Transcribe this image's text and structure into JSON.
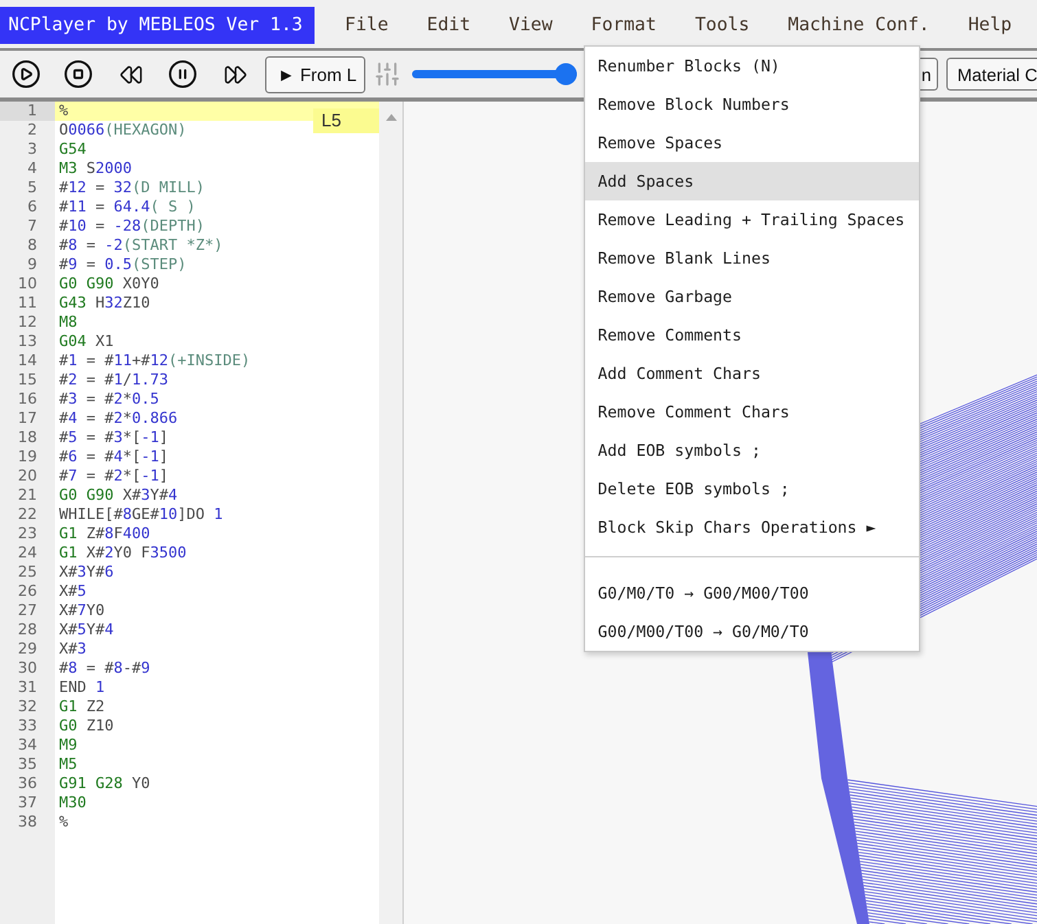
{
  "app_title": "NCPlayer by MEBLEOS Ver 1.3",
  "menubar": [
    {
      "label": "File"
    },
    {
      "label": "Edit"
    },
    {
      "label": "View"
    },
    {
      "label": "Format",
      "entries": [
        {
          "kind": "item",
          "label": "Renumber Blocks (N)",
          "highlighted": false
        },
        {
          "kind": "item",
          "label": "Remove Block Numbers",
          "highlighted": false
        },
        {
          "kind": "item",
          "label": "Remove Spaces",
          "highlighted": false
        },
        {
          "kind": "item",
          "label": "Add Spaces",
          "highlighted": true
        },
        {
          "kind": "item",
          "label": "Remove Leading + Trailing Spaces",
          "highlighted": false
        },
        {
          "kind": "item",
          "label": "Remove Blank Lines",
          "highlighted": false
        },
        {
          "kind": "item",
          "label": "Remove Garbage",
          "highlighted": false
        },
        {
          "kind": "item",
          "label": "Remove Comments",
          "highlighted": false
        },
        {
          "kind": "item",
          "label": "Add Comment Chars",
          "highlighted": false
        },
        {
          "kind": "item",
          "label": "Remove Comment Chars",
          "highlighted": false
        },
        {
          "kind": "item",
          "label": "Add EOB symbols ;",
          "highlighted": false
        },
        {
          "kind": "item",
          "label": "Delete EOB symbols ;",
          "highlighted": false
        },
        {
          "kind": "item",
          "label": "Block Skip Chars Operations ►",
          "highlighted": false
        },
        {
          "kind": "separator"
        },
        {
          "kind": "item",
          "label": "G0/M0/T0 → G00/M00/T00",
          "highlighted": false
        },
        {
          "kind": "item",
          "label": "G00/M00/T00 → G0/M0/T0",
          "highlighted": false
        }
      ]
    },
    {
      "label": "Tools"
    },
    {
      "label": "Machine Conf."
    },
    {
      "label": "Help"
    }
  ],
  "toolbar": {
    "from_line_button": "► From L",
    "speed_slider": {
      "level": 1
    },
    "buttons": [
      "n",
      "Material C"
    ]
  },
  "editor": {
    "tooltip": "L5",
    "lines": [
      {
        "number": "1",
        "current": true,
        "tokens": [
          {
            "kind": "plain",
            "text": "%"
          }
        ]
      },
      {
        "number": "2",
        "current": false,
        "tokens": [
          {
            "kind": "plain",
            "text": "O"
          },
          {
            "kind": "num",
            "text": "0066"
          },
          {
            "kind": "comment",
            "text": "(HEXAGON)"
          }
        ]
      },
      {
        "number": "3",
        "current": false,
        "tokens": [
          {
            "kind": "code",
            "text": "G54"
          }
        ]
      },
      {
        "number": "4",
        "current": false,
        "tokens": [
          {
            "kind": "code",
            "text": "M3"
          },
          {
            "kind": "plain",
            "text": " S"
          },
          {
            "kind": "num",
            "text": "2000"
          }
        ]
      },
      {
        "number": "5",
        "current": false,
        "tokens": [
          {
            "kind": "plain",
            "text": "#"
          },
          {
            "kind": "num",
            "text": "12"
          },
          {
            "kind": "plain",
            "text": " = "
          },
          {
            "kind": "num",
            "text": "32"
          },
          {
            "kind": "comment",
            "text": "(D MILL)"
          }
        ]
      },
      {
        "number": "6",
        "current": false,
        "tokens": [
          {
            "kind": "plain",
            "text": "#"
          },
          {
            "kind": "num",
            "text": "11"
          },
          {
            "kind": "plain",
            "text": " = "
          },
          {
            "kind": "num",
            "text": "64.4"
          },
          {
            "kind": "comment",
            "text": "( S )"
          }
        ]
      },
      {
        "number": "7",
        "current": false,
        "tokens": [
          {
            "kind": "plain",
            "text": "#"
          },
          {
            "kind": "num",
            "text": "10"
          },
          {
            "kind": "plain",
            "text": " = "
          },
          {
            "kind": "num",
            "text": "-28"
          },
          {
            "kind": "comment",
            "text": "(DEPTH)"
          }
        ]
      },
      {
        "number": "8",
        "current": false,
        "tokens": [
          {
            "kind": "plain",
            "text": "#"
          },
          {
            "kind": "num",
            "text": "8"
          },
          {
            "kind": "plain",
            "text": " = "
          },
          {
            "kind": "num",
            "text": "-2"
          },
          {
            "kind": "comment",
            "text": "(START *Z*)"
          }
        ]
      },
      {
        "number": "9",
        "current": false,
        "tokens": [
          {
            "kind": "plain",
            "text": "#"
          },
          {
            "kind": "num",
            "text": "9"
          },
          {
            "kind": "plain",
            "text": " = "
          },
          {
            "kind": "num",
            "text": "0.5"
          },
          {
            "kind": "comment",
            "text": "(STEP)"
          }
        ]
      },
      {
        "number": "10",
        "current": false,
        "tokens": [
          {
            "kind": "code",
            "text": "G0 G90"
          },
          {
            "kind": "plain",
            "text": " X0Y0"
          }
        ]
      },
      {
        "number": "11",
        "current": false,
        "tokens": [
          {
            "kind": "code",
            "text": "G43"
          },
          {
            "kind": "plain",
            "text": " H"
          },
          {
            "kind": "num",
            "text": "32"
          },
          {
            "kind": "plain",
            "text": "Z10"
          }
        ]
      },
      {
        "number": "12",
        "current": false,
        "tokens": [
          {
            "kind": "code",
            "text": "M8"
          }
        ]
      },
      {
        "number": "13",
        "current": false,
        "tokens": [
          {
            "kind": "code",
            "text": "G04"
          },
          {
            "kind": "plain",
            "text": " X1"
          }
        ]
      },
      {
        "number": "14",
        "current": false,
        "tokens": [
          {
            "kind": "plain",
            "text": "#"
          },
          {
            "kind": "num",
            "text": "1"
          },
          {
            "kind": "plain",
            "text": " = #"
          },
          {
            "kind": "num",
            "text": "11"
          },
          {
            "kind": "plain",
            "text": "+#"
          },
          {
            "kind": "num",
            "text": "12"
          },
          {
            "kind": "comment",
            "text": "(+INSIDE)"
          }
        ]
      },
      {
        "number": "15",
        "current": false,
        "tokens": [
          {
            "kind": "plain",
            "text": "#"
          },
          {
            "kind": "num",
            "text": "2"
          },
          {
            "kind": "plain",
            "text": " = #"
          },
          {
            "kind": "num",
            "text": "1"
          },
          {
            "kind": "plain",
            "text": "/"
          },
          {
            "kind": "num",
            "text": "1.73"
          }
        ]
      },
      {
        "number": "16",
        "current": false,
        "tokens": [
          {
            "kind": "plain",
            "text": "#"
          },
          {
            "kind": "num",
            "text": "3"
          },
          {
            "kind": "plain",
            "text": " = #"
          },
          {
            "kind": "num",
            "text": "2"
          },
          {
            "kind": "plain",
            "text": "*"
          },
          {
            "kind": "num",
            "text": "0.5"
          }
        ]
      },
      {
        "number": "17",
        "current": false,
        "tokens": [
          {
            "kind": "plain",
            "text": "#"
          },
          {
            "kind": "num",
            "text": "4"
          },
          {
            "kind": "plain",
            "text": " = #"
          },
          {
            "kind": "num",
            "text": "2"
          },
          {
            "kind": "plain",
            "text": "*"
          },
          {
            "kind": "num",
            "text": "0.866"
          }
        ]
      },
      {
        "number": "18",
        "current": false,
        "tokens": [
          {
            "kind": "plain",
            "text": "#"
          },
          {
            "kind": "num",
            "text": "5"
          },
          {
            "kind": "plain",
            "text": " = #"
          },
          {
            "kind": "num",
            "text": "3"
          },
          {
            "kind": "plain",
            "text": "*["
          },
          {
            "kind": "num",
            "text": "-1"
          },
          {
            "kind": "plain",
            "text": "]"
          }
        ]
      },
      {
        "number": "19",
        "current": false,
        "tokens": [
          {
            "kind": "plain",
            "text": "#"
          },
          {
            "kind": "num",
            "text": "6"
          },
          {
            "kind": "plain",
            "text": " = #"
          },
          {
            "kind": "num",
            "text": "4"
          },
          {
            "kind": "plain",
            "text": "*["
          },
          {
            "kind": "num",
            "text": "-1"
          },
          {
            "kind": "plain",
            "text": "]"
          }
        ]
      },
      {
        "number": "20",
        "current": false,
        "tokens": [
          {
            "kind": "plain",
            "text": "#"
          },
          {
            "kind": "num",
            "text": "7"
          },
          {
            "kind": "plain",
            "text": " = #"
          },
          {
            "kind": "num",
            "text": "2"
          },
          {
            "kind": "plain",
            "text": "*["
          },
          {
            "kind": "num",
            "text": "-1"
          },
          {
            "kind": "plain",
            "text": "]"
          }
        ]
      },
      {
        "number": "21",
        "current": false,
        "tokens": [
          {
            "kind": "code",
            "text": "G0 G90"
          },
          {
            "kind": "plain",
            "text": " X#"
          },
          {
            "kind": "num",
            "text": "3"
          },
          {
            "kind": "plain",
            "text": "Y#"
          },
          {
            "kind": "num",
            "text": "4"
          }
        ]
      },
      {
        "number": "22",
        "current": false,
        "tokens": [
          {
            "kind": "plain",
            "text": "WHILE[#"
          },
          {
            "kind": "num",
            "text": "8"
          },
          {
            "kind": "plain",
            "text": "GE#"
          },
          {
            "kind": "num",
            "text": "10"
          },
          {
            "kind": "plain",
            "text": "]DO "
          },
          {
            "kind": "num",
            "text": "1"
          }
        ]
      },
      {
        "number": "23",
        "current": false,
        "tokens": [
          {
            "kind": "code",
            "text": "G1"
          },
          {
            "kind": "plain",
            "text": " Z#"
          },
          {
            "kind": "num",
            "text": "8"
          },
          {
            "kind": "plain",
            "text": "F"
          },
          {
            "kind": "num",
            "text": "400"
          }
        ]
      },
      {
        "number": "24",
        "current": false,
        "tokens": [
          {
            "kind": "code",
            "text": "G1"
          },
          {
            "kind": "plain",
            "text": " X#"
          },
          {
            "kind": "num",
            "text": "2"
          },
          {
            "kind": "plain",
            "text": "Y0 F"
          },
          {
            "kind": "num",
            "text": "3500"
          }
        ]
      },
      {
        "number": "25",
        "current": false,
        "tokens": [
          {
            "kind": "plain",
            "text": "X#"
          },
          {
            "kind": "num",
            "text": "3"
          },
          {
            "kind": "plain",
            "text": "Y#"
          },
          {
            "kind": "num",
            "text": "6"
          }
        ]
      },
      {
        "number": "26",
        "current": false,
        "tokens": [
          {
            "kind": "plain",
            "text": "X#"
          },
          {
            "kind": "num",
            "text": "5"
          }
        ]
      },
      {
        "number": "27",
        "current": false,
        "tokens": [
          {
            "kind": "plain",
            "text": "X#"
          },
          {
            "kind": "num",
            "text": "7"
          },
          {
            "kind": "plain",
            "text": "Y0"
          }
        ]
      },
      {
        "number": "28",
        "current": false,
        "tokens": [
          {
            "kind": "plain",
            "text": "X#"
          },
          {
            "kind": "num",
            "text": "5"
          },
          {
            "kind": "plain",
            "text": "Y#"
          },
          {
            "kind": "num",
            "text": "4"
          }
        ]
      },
      {
        "number": "29",
        "current": false,
        "tokens": [
          {
            "kind": "plain",
            "text": "X#"
          },
          {
            "kind": "num",
            "text": "3"
          }
        ]
      },
      {
        "number": "30",
        "current": false,
        "tokens": [
          {
            "kind": "plain",
            "text": "#"
          },
          {
            "kind": "num",
            "text": "8"
          },
          {
            "kind": "plain",
            "text": " = #"
          },
          {
            "kind": "num",
            "text": "8"
          },
          {
            "kind": "plain",
            "text": "-#"
          },
          {
            "kind": "num",
            "text": "9"
          }
        ]
      },
      {
        "number": "31",
        "current": false,
        "tokens": [
          {
            "kind": "plain",
            "text": "END "
          },
          {
            "kind": "num",
            "text": "1"
          }
        ]
      },
      {
        "number": "32",
        "current": false,
        "tokens": [
          {
            "kind": "code",
            "text": "G1"
          },
          {
            "kind": "plain",
            "text": " Z2"
          }
        ]
      },
      {
        "number": "33",
        "current": false,
        "tokens": [
          {
            "kind": "code",
            "text": "G0"
          },
          {
            "kind": "plain",
            "text": " Z10"
          }
        ]
      },
      {
        "number": "34",
        "current": false,
        "tokens": [
          {
            "kind": "code",
            "text": "M9"
          }
        ]
      },
      {
        "number": "35",
        "current": false,
        "tokens": [
          {
            "kind": "code",
            "text": "M5"
          }
        ]
      },
      {
        "number": "36",
        "current": false,
        "tokens": [
          {
            "kind": "code",
            "text": "G91 G28"
          },
          {
            "kind": "plain",
            "text": " Y0"
          }
        ]
      },
      {
        "number": "37",
        "current": false,
        "tokens": [
          {
            "kind": "code",
            "text": "M30"
          }
        ]
      },
      {
        "number": "38",
        "current": false,
        "tokens": [
          {
            "kind": "plain",
            "text": "%"
          }
        ]
      }
    ]
  }
}
